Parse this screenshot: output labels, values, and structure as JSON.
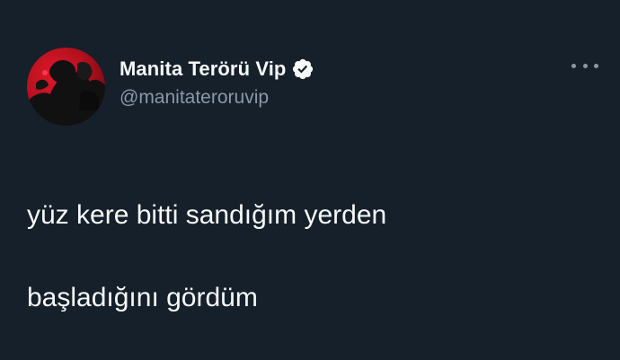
{
  "tweet": {
    "author": {
      "display_name": "Manita Terörü Vip",
      "handle": "@manitateroruvip",
      "verified": true,
      "avatar_icon": "silhouette-avatar-icon",
      "verified_icon": "verified-badge-icon"
    },
    "more_icon": "more-options-icon",
    "text_lines": [
      "yüz kere bitti sandığım yerden",
      "başladığını gördüm"
    ]
  },
  "colors": {
    "background": "#15202b",
    "text_primary": "#f7f9f9",
    "text_secondary": "#8b98a5",
    "avatar_accent": "#c1121f"
  }
}
